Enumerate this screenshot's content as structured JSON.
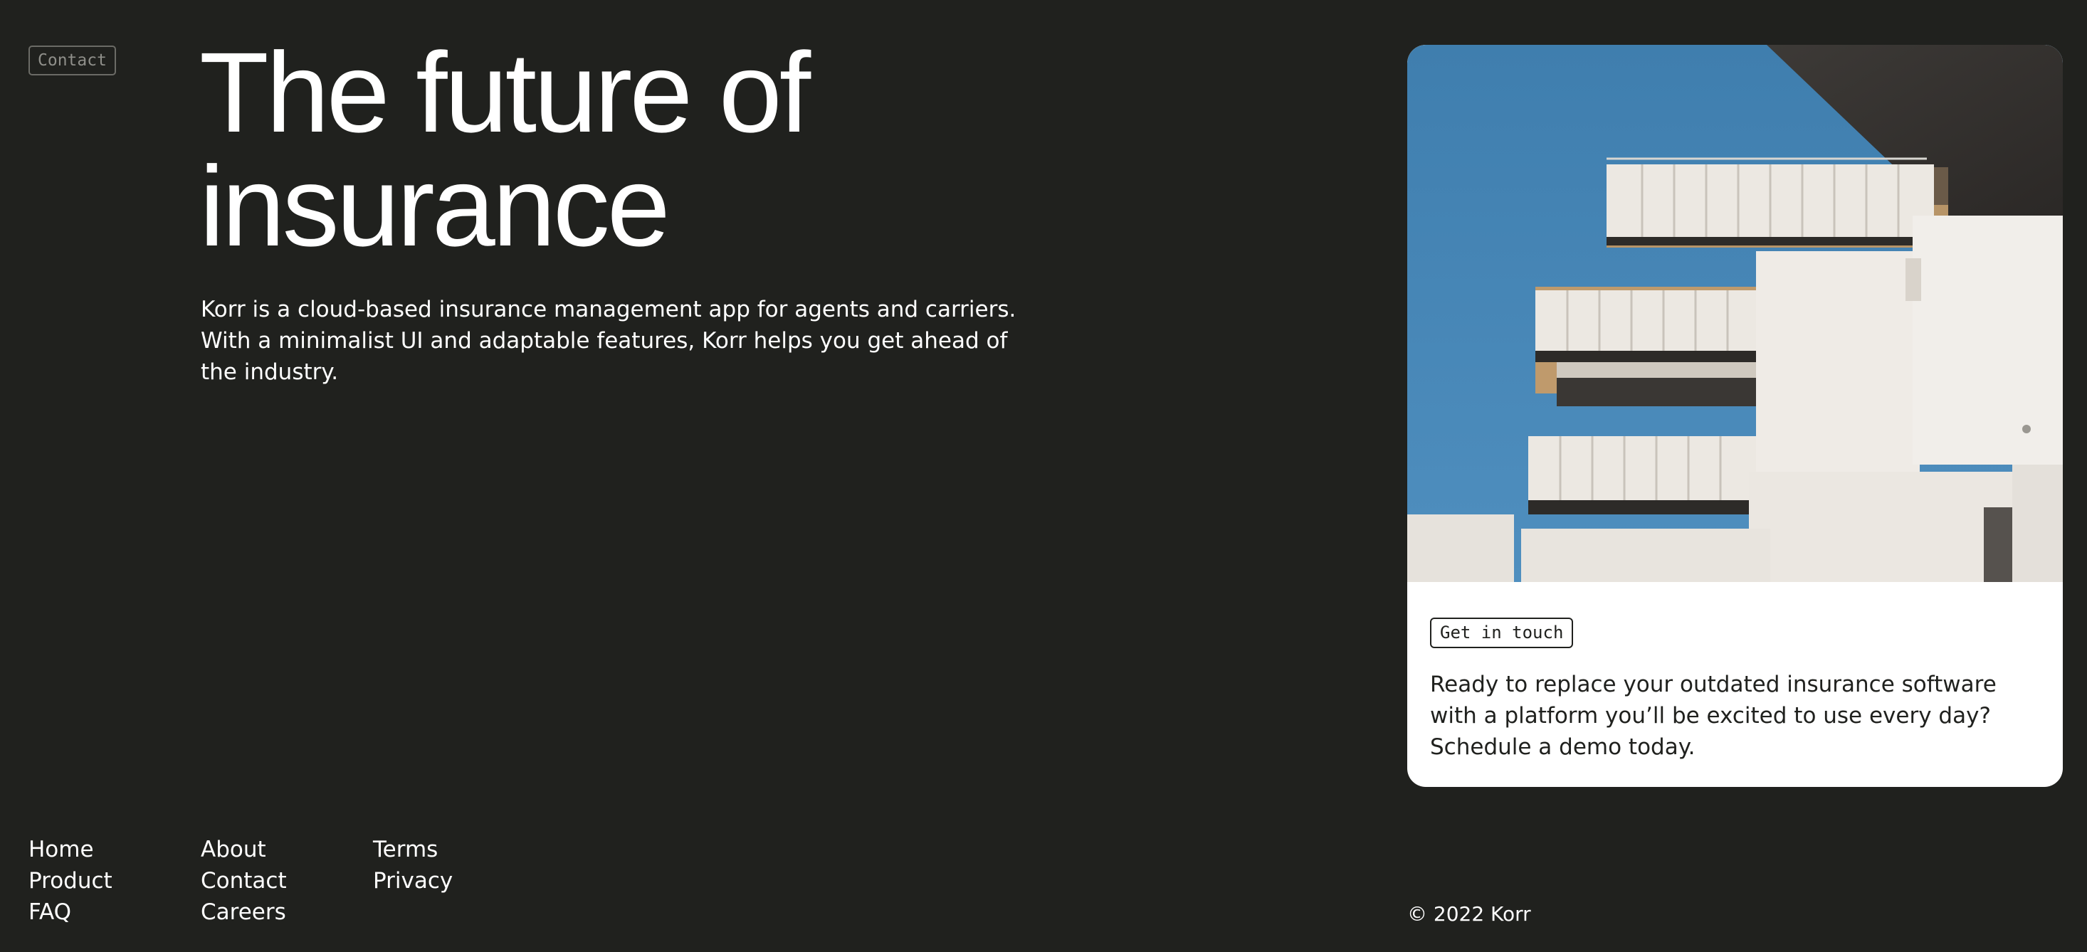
{
  "nav": {
    "contact_label": "Contact"
  },
  "hero": {
    "headline_line1": "The future of",
    "headline_line2": "insurance",
    "description": "Korr is a cloud-based insurance management app for agents and carriers. With a minimalist UI and adaptable features, Korr helps you get ahead of the industry."
  },
  "card": {
    "image_icon": "building-photo",
    "button_label": "Get in touch",
    "text": "Ready to replace your outdated insurance software with a platform you’ll be excited to use every day? Schedule a demo today."
  },
  "footer": {
    "columns": [
      {
        "links": [
          "Home",
          "Product",
          "FAQ"
        ]
      },
      {
        "links": [
          "About",
          "Contact",
          "Careers"
        ]
      },
      {
        "links": [
          "Terms",
          "Privacy"
        ]
      }
    ],
    "copyright": "© 2022 Korr"
  },
  "colors": {
    "background": "#20211e",
    "text": "#ffffff",
    "card_background": "#ffffff",
    "card_text": "#20211e",
    "sky": "#4a86b4"
  }
}
